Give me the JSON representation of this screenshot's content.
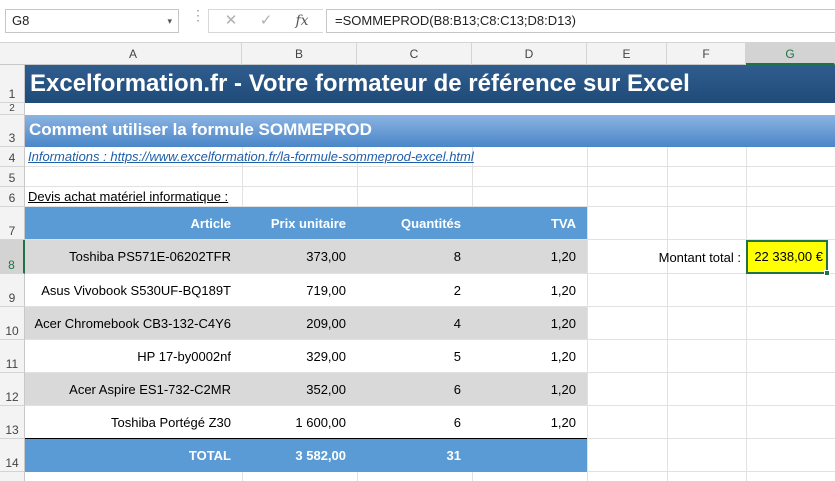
{
  "formula_bar": {
    "name_box": "G8",
    "dropdown_glyph": "▾",
    "cancel_glyph": "✕",
    "enter_glyph": "✓",
    "fx_glyph": "fx",
    "formula": "=SOMMEPROD(B8:B13;C8:C13;D8:D13)"
  },
  "columns": [
    "A",
    "B",
    "C",
    "D",
    "E",
    "F",
    "G"
  ],
  "selected_column": "G",
  "rows": [
    "1",
    "2",
    "3",
    "4",
    "5",
    "6",
    "7",
    "8",
    "9",
    "10",
    "11",
    "12",
    "13",
    "14"
  ],
  "selected_row": "8",
  "banner_title": "Excelformation.fr - Votre formateur de référence sur Excel",
  "subtitle": "Comment utiliser la formule SOMMEPROD",
  "info_link": "Informations : https://www.excelformation.fr/la-formule-sommeprod-excel.html",
  "devis_label": "Devis achat matériel informatique :",
  "table": {
    "headers": [
      "Article",
      "Prix unitaire",
      "Quantités",
      "TVA"
    ],
    "rows": [
      [
        "Toshiba PS571E-06202TFR",
        "373,00",
        "8",
        "1,20"
      ],
      [
        "Asus Vivobook S530UF-BQ189T",
        "719,00",
        "2",
        "1,20"
      ],
      [
        "Acer Chromebook CB3-132-C4Y6",
        "209,00",
        "4",
        "1,20"
      ],
      [
        "HP 17-by0002nf",
        "329,00",
        "5",
        "1,20"
      ],
      [
        "Acer Aspire ES1-732-C2MR",
        "352,00",
        "6",
        "1,20"
      ],
      [
        "Toshiba Portégé Z30",
        "1 600,00",
        "6",
        "1,20"
      ]
    ],
    "total": [
      "TOTAL",
      "3 582,00",
      "31",
      ""
    ]
  },
  "total_label": "Montant total :",
  "total_value": "22 338,00 €",
  "colors": {
    "header_blue": "#5b9bd5",
    "row_gray": "#d9d9d9",
    "highlight_yellow": "#ffff00",
    "selection_green": "#217346",
    "banner_dark": "#1f4b79",
    "link_blue": "#1f5fa8"
  }
}
